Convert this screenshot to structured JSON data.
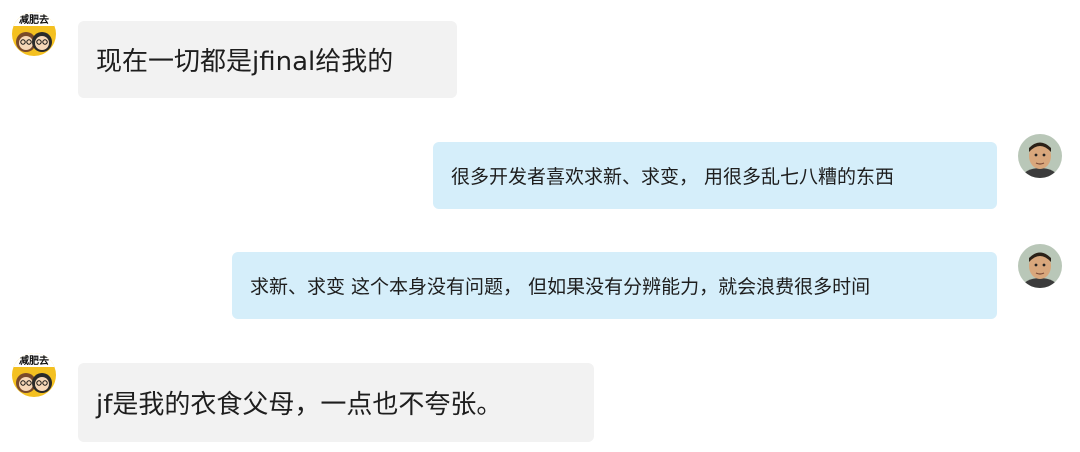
{
  "chat": {
    "messages": [
      {
        "side": "left",
        "sender_avatar": "cartoon-couple-avatar",
        "avatar_caption": "减肥去",
        "text": "现在一切都是jfinal给我的"
      },
      {
        "side": "right",
        "sender_avatar": "man-photo-avatar",
        "text": "很多开发者喜欢求新、求变，  用很多乱七八糟的东西"
      },
      {
        "side": "right",
        "sender_avatar": "man-photo-avatar",
        "text": "求新、求变 这个本身没有问题，  但如果没有分辨能力，就会浪费很多时间"
      },
      {
        "side": "left",
        "sender_avatar": "cartoon-couple-avatar",
        "avatar_caption": "减肥去",
        "text": "jf是我的衣食父母，一点也不夸张。"
      }
    ]
  },
  "colors": {
    "left_bubble": "#f2f2f2",
    "right_bubble": "#d5eefa",
    "text": "#1e1e1e"
  }
}
